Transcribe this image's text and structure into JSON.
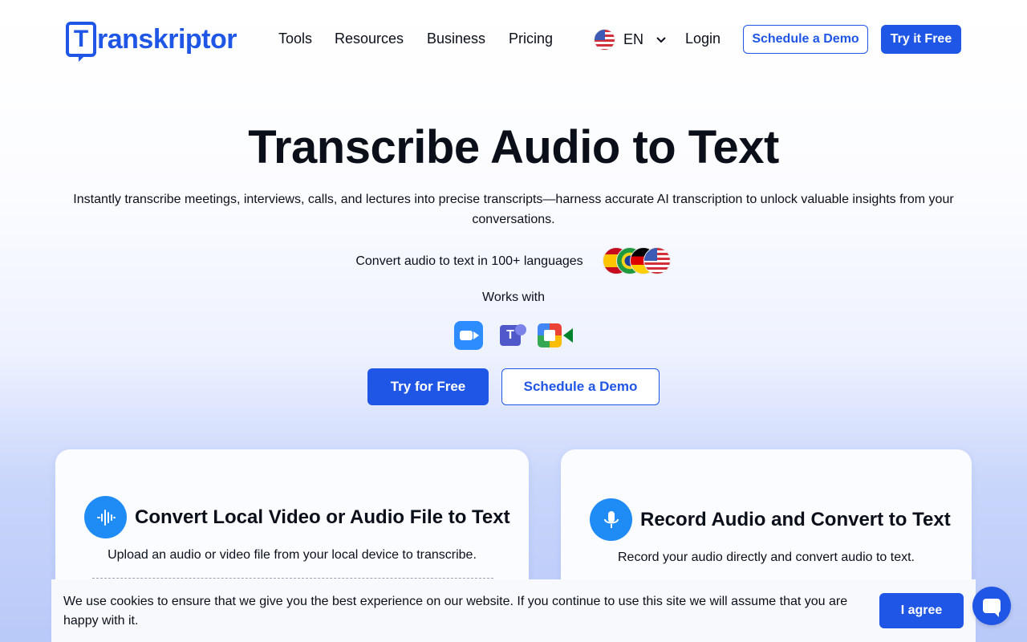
{
  "nav": {
    "logo_text": "ranskriptor",
    "logo_mark": "T",
    "items": [
      "Tools",
      "Resources",
      "Business",
      "Pricing"
    ],
    "language": "EN",
    "login": "Login",
    "schedule_demo": "Schedule a Demo",
    "try_free": "Try it Free"
  },
  "hero": {
    "title": "Transcribe Audio to Text",
    "subtitle": "Instantly transcribe meetings, interviews, calls, and lectures into precise transcripts—harness accurate AI transcription to unlock valuable insights from your conversations.",
    "languages_text": "Convert audio to text in 100+ languages",
    "works_with": "Works with",
    "cta_primary": "Try for Free",
    "cta_secondary": "Schedule a Demo"
  },
  "cards": {
    "upload": {
      "title": "Convert Local Video or Audio File to Text",
      "description": "Upload an audio or video file from your local device to transcribe."
    },
    "record": {
      "title": "Record Audio and Convert to Text",
      "description": "Record your audio directly and convert audio to text."
    }
  },
  "cookie": {
    "text": "We use cookies to ensure that we give you the best experience on our website. If you continue to use this site we will assume that you are happy with it.",
    "agree": "I agree"
  },
  "colors": {
    "brand": "#1f56e6",
    "icon_blue": "#1f8cf5"
  },
  "icons": [
    "us-flag-icon",
    "chevron-down-icon",
    "zoom-icon",
    "teams-icon",
    "google-meet-icon",
    "audio-wave-icon",
    "microphone-icon",
    "chat-icon"
  ]
}
